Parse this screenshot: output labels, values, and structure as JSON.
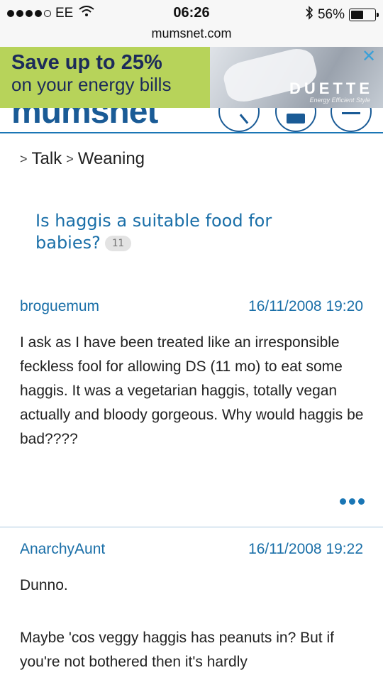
{
  "status_bar": {
    "carrier": "EE",
    "time": "06:26",
    "battery": "56%",
    "battery_level": 0.56
  },
  "url": "mumsnet.com",
  "ad": {
    "title": "Save up to 25%",
    "subtitle": "on your energy bills",
    "brand": "DUETTE",
    "tagline": "Energy Efficient Style",
    "close": "✕"
  },
  "header": {
    "logo": "mumsnet"
  },
  "breadcrumb": {
    "sep1": ">",
    "item1": "Talk",
    "sep2": ">",
    "item2": "Weaning"
  },
  "thread": {
    "title": "Is haggis a suitable food for babies?",
    "reply_count": "11"
  },
  "posts": [
    {
      "author": "broguemum",
      "date": "16/11/2008 19:20",
      "body": "I ask as I have been treated like an irresponsible feckless fool for allowing DS (11 mo) to eat some haggis. It was a vegetarian haggis, totally vegan actually and bloody gorgeous. Why would haggis be bad????"
    },
    {
      "author": "AnarchyAunt",
      "date": "16/11/2008 19:22",
      "body1": "Dunno.",
      "body2": "Maybe 'cos veggy haggis has peanuts in? But if you're not bothered then it's hardly"
    }
  ]
}
